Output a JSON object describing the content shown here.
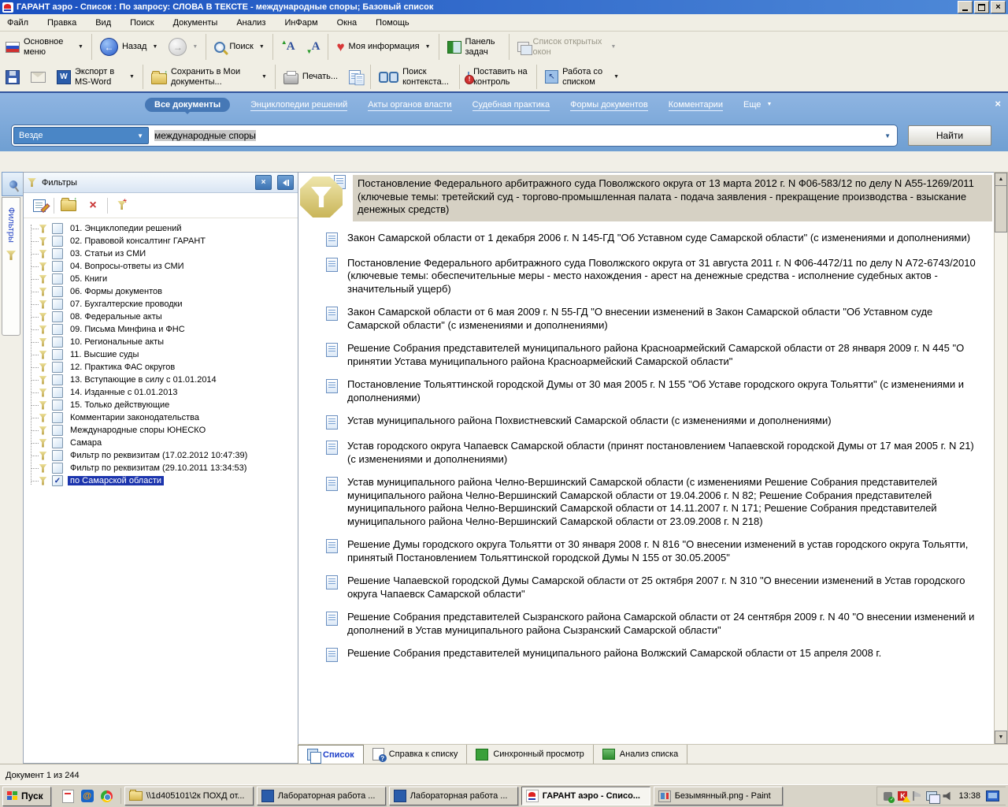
{
  "colors": {
    "titlebar_blue": "#1a50c0",
    "band_blue": "#7fa9da",
    "accent_blue": "#4a86c6",
    "selection_navy": "#1b34ad",
    "highlight_tan": "#d6d1c4",
    "funnel_gold": "#c9b559"
  },
  "icons": {
    "dropdown": "▼",
    "chevron_down": "▼",
    "back_arrow": "←",
    "forward_arrow": "→",
    "heart": "♥",
    "close": "×",
    "up_arrow": "▲",
    "down_arrow": "▼",
    "font_letter": "A",
    "word_letter": "W",
    "bang": "!",
    "cursor": "↖",
    "sync_arrows": "↔",
    "plus": "+",
    "mail_at": "@",
    "green_up": "↑",
    "question": "?",
    "av_letter": "K"
  },
  "window": {
    "title": "ГАРАНТ аэро - Список : По запросу: СЛОВА В ТЕКСТЕ - международные споры; Базовый список"
  },
  "menu": {
    "items": [
      "Файл",
      "Правка",
      "Вид",
      "Поиск",
      "Документы",
      "Анализ",
      "ИнФарм",
      "Окна",
      "Помощь"
    ]
  },
  "toolbar_main": {
    "main_menu": "Основное меню",
    "back": "Назад",
    "search": "Поиск",
    "my_info": "Моя информация",
    "task_panel": "Панель задач",
    "open_windows": "Список открытых окон"
  },
  "toolbar_actions": {
    "export_word": "Экспорт в MS-Word",
    "save_docs": "Сохранить в Мои документы...",
    "print": "Печать...",
    "context_search": "Поиск контекста...",
    "on_control": "Поставить на контроль",
    "work_list": "Работа со списком"
  },
  "filter_tabs": {
    "items": [
      {
        "label": "Все документы",
        "selected": true
      },
      {
        "label": "Энциклопедии решений"
      },
      {
        "label": "Акты органов власти"
      },
      {
        "label": "Судебная практика"
      },
      {
        "label": "Формы документов"
      },
      {
        "label": "Комментарии"
      },
      {
        "label": "Еще",
        "chevron": true
      }
    ]
  },
  "search": {
    "scope": "Везде",
    "query": "международные споры",
    "find": "Найти"
  },
  "filters": {
    "title": "Фильтры",
    "side_tab": "Фильтры",
    "items": [
      {
        "label": "01. Энциклопедии решений"
      },
      {
        "label": "02. Правовой консалтинг ГАРАНТ"
      },
      {
        "label": "03. Статьи из СМИ"
      },
      {
        "label": "04. Вопросы-ответы из СМИ"
      },
      {
        "label": "05. Книги"
      },
      {
        "label": "06. Формы документов"
      },
      {
        "label": "07. Бухгалтерские проводки"
      },
      {
        "label": "08. Федеральные акты"
      },
      {
        "label": "09. Письма Минфина и ФНС"
      },
      {
        "label": "10. Региональные акты"
      },
      {
        "label": "11. Высшие суды"
      },
      {
        "label": "12. Практика ФАС округов"
      },
      {
        "label": "13. Вступающие в силу с 01.01.2014"
      },
      {
        "label": "14. Изданные с 01.01.2013"
      },
      {
        "label": "15. Только действующие"
      },
      {
        "label": "Комментарии законодательства"
      },
      {
        "label": "Международные споры ЮНЕСКО"
      },
      {
        "label": "Самара"
      },
      {
        "label": "Фильтр по реквизитам (17.02.2012 10:47:39)"
      },
      {
        "label": "Фильтр по реквизитам (29.10.2011 13:34:53)"
      },
      {
        "label": "по Самарской области",
        "checked": true,
        "selected": true
      }
    ]
  },
  "documents": {
    "featured": {
      "text": "Постановление Федерального арбитражного суда Поволжского округа от 13 марта 2012 г. N Ф06-583/12 по делу N А55-1269/2011 (ключевые темы: третейский суд - торгово-промышленная палата - подача заявления - прекращение производства - взыскание денежных средств)"
    },
    "items": [
      {
        "text": "Закон Самарской области от 1 декабря 2006 г. N 145-ГД \"Об Уставном суде Самарской области\" (с изменениями и дополнениями)"
      },
      {
        "text": "Постановление Федерального арбитражного суда Поволжского округа от 31 августа 2011 г. N Ф06-4472/11 по делу N А72-6743/2010 (ключевые темы: обеспечительные меры - место нахождения - арест на денежные средства - исполнение судебных актов - значительный ущерб)"
      },
      {
        "text": "Закон Самарской области от 6 мая 2009 г. N 55-ГД \"О внесении изменений в Закон Самарской области \"Об Уставном суде Самарской области\" (с изменениями и дополнениями)"
      },
      {
        "text": "Решение Собрания представителей муниципального района Красноармейский Самарской области от 28 января 2009 г. N 445 \"О принятии Устава муниципального района Красноармейский Самарской области\""
      },
      {
        "text": "Постановление Тольяттинской городской Думы от 30 мая 2005 г. N 155 \"Об Уставе городского округа Тольятти\" (с изменениями и дополнениями)"
      },
      {
        "text": "Устав муниципального района Похвистневский Самарской области (с изменениями и дополнениями)"
      },
      {
        "text": "Устав городского округа Чапаевск Самарской области (принят постановлением Чапаевской городской Думы от 17 мая 2005 г. N 21) (с изменениями и дополнениями)"
      },
      {
        "text": "Устав муниципального района Челно-Вершинский Самарской области (с изменениями Решение Собрания представителей муниципального района Челно-Вершинский Самарской области от 19.04.2006 г. N 82; Решение Собрания представителей муниципального района Челно-Вершинский Самарской области от 14.11.2007 г. N 171; Решение Собрания представителей муниципального района Челно-Вершинский Самарской области от 23.09.2008 г. N 218)"
      },
      {
        "text": "Решение Думы городского округа Тольятти от 30 января 2008 г. N 816 \"О внесении изменений в устав городского округа Тольятти, принятый Постановлением Тольяттинской городской Думы N 155 от 30.05.2005\""
      },
      {
        "text": "Решение Чапаевской городской Думы Самарской области от 25 октября 2007 г. N 310 \"О внесении изменений в Устав городского округа Чапаевск Самарской области\""
      },
      {
        "text": "Решение Собрания представителей Сызранского района Самарской области от 24 сентября 2009 г. N 40 \"О внесении изменений и дополнений в Устав муниципального района Сызранский Самарской области\""
      },
      {
        "text": "Решение Собрания представителей муниципального района Волжский Самарской области от 15 апреля 2008 г."
      }
    ]
  },
  "view_tabs": {
    "items": [
      {
        "label": "Список",
        "icon": "ico-list",
        "active": true
      },
      {
        "label": "Справка к списку",
        "icon": "ico-help"
      },
      {
        "label": "Синхронный просмотр",
        "icon": "ico-sync"
      },
      {
        "label": "Анализ списка",
        "icon": "ico-analysis"
      }
    ]
  },
  "status": {
    "text": "Документ 1 из 244"
  },
  "taskbar": {
    "start": "Пуск",
    "buttons": [
      {
        "label": "\\\\1d405101\\2к ПОХД от...",
        "icon": "ti-folder"
      },
      {
        "label": "Лабораторная работа ...",
        "icon": "ti-word"
      },
      {
        "label": "Лабораторная работа ...",
        "icon": "ti-word"
      },
      {
        "label": "ГАРАНТ аэро - Списо...",
        "icon": "ti-garant",
        "active": true
      },
      {
        "label": "Безымянный.png - Paint",
        "icon": "ti-paint"
      }
    ],
    "clock": "13:38"
  }
}
